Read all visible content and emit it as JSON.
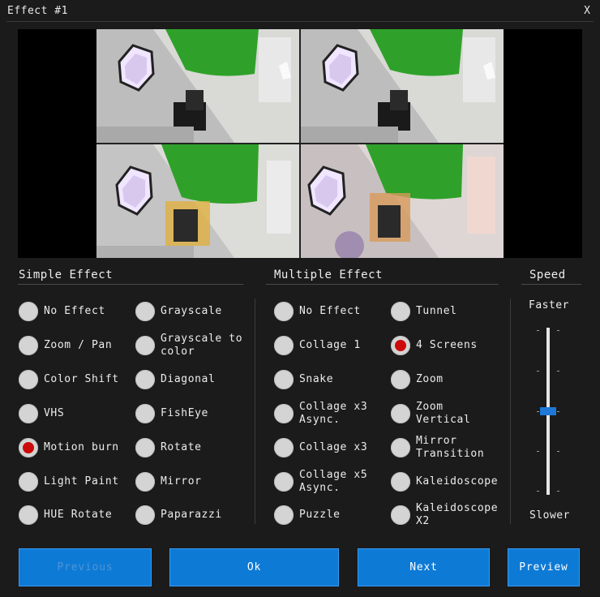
{
  "window": {
    "title": "Effect #1",
    "close_label": "X"
  },
  "sections": {
    "simple": "Simple Effect",
    "multiple": "Multiple Effect",
    "speed": "Speed"
  },
  "simple_effects": [
    {
      "label": "No Effect",
      "selected": false
    },
    {
      "label": "Grayscale",
      "selected": false
    },
    {
      "label": "Zoom / Pan",
      "selected": false
    },
    {
      "label": "Grayscale to\ncolor",
      "selected": false
    },
    {
      "label": "Color Shift",
      "selected": false
    },
    {
      "label": "Diagonal",
      "selected": false
    },
    {
      "label": "VHS",
      "selected": false
    },
    {
      "label": "FishEye",
      "selected": false
    },
    {
      "label": "Motion burn",
      "selected": true
    },
    {
      "label": "Rotate",
      "selected": false
    },
    {
      "label": "Light Paint",
      "selected": false
    },
    {
      "label": "Mirror",
      "selected": false
    },
    {
      "label": "HUE Rotate",
      "selected": false
    },
    {
      "label": "Paparazzi",
      "selected": false
    }
  ],
  "multiple_effects": [
    {
      "label": "No Effect",
      "selected": false
    },
    {
      "label": "Tunnel",
      "selected": false
    },
    {
      "label": "Collage 1",
      "selected": false
    },
    {
      "label": "4 Screens",
      "selected": true
    },
    {
      "label": "Snake",
      "selected": false
    },
    {
      "label": "Zoom",
      "selected": false
    },
    {
      "label": "Collage x3\nAsync.",
      "selected": false
    },
    {
      "label": "Zoom\nVertical",
      "selected": false
    },
    {
      "label": "Collage x3",
      "selected": false
    },
    {
      "label": "Mirror\nTransition",
      "selected": false
    },
    {
      "label": "Collage x5\nAsync.",
      "selected": false
    },
    {
      "label": "Kaleidoscope",
      "selected": false
    },
    {
      "label": "Puzzle",
      "selected": false
    },
    {
      "label": "Kaleidoscope\nX2",
      "selected": false
    }
  ],
  "speed": {
    "top_label": "Faster",
    "bottom_label": "Slower",
    "level": 0.5
  },
  "buttons": {
    "previous": "Previous",
    "ok": "Ok",
    "next": "Next",
    "preview": "Preview"
  },
  "colors": {
    "accent": "#0d7ad6",
    "selected_dot": "#cc0a0a",
    "screen_green": "#2fa12a"
  }
}
